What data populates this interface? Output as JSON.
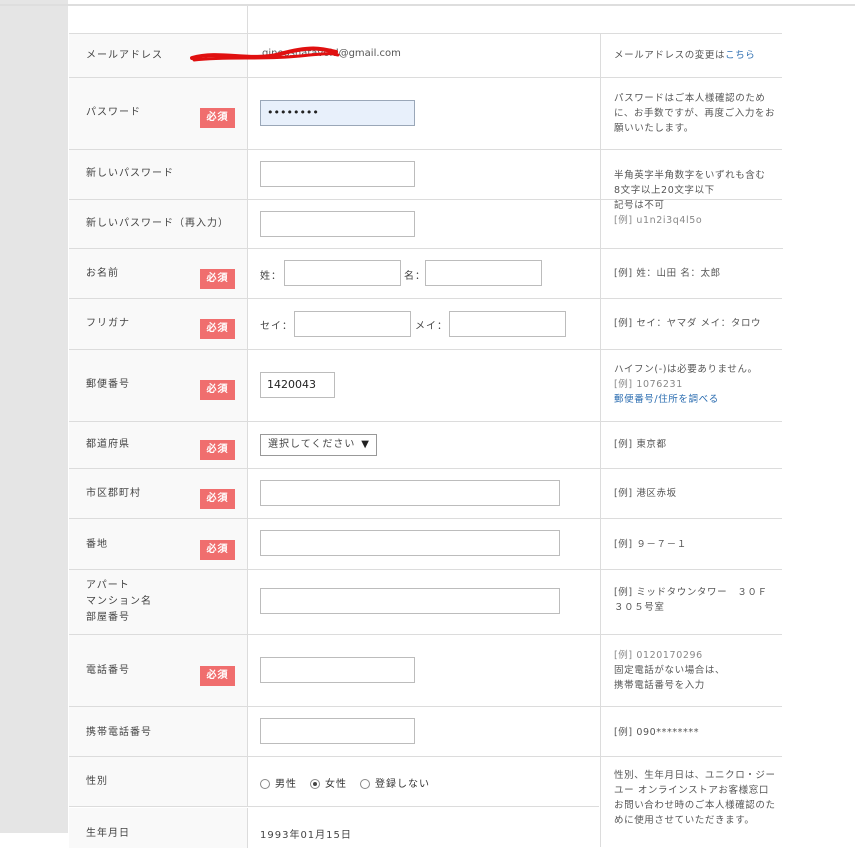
{
  "required_label": "必須",
  "email": {
    "label": "メールアドレス",
    "value": "ginooshatavoid@gmail.com",
    "note": "メールアドレスの変更は",
    "note_link": "こちら"
  },
  "password": {
    "label": "パスワード",
    "value": "••••••••",
    "note": "パスワードはご本人様確認のために、お手数ですが、再度ご入力をお願いいたします。"
  },
  "new_password": {
    "label": "新しいパスワード",
    "confirm_label": "新しいパスワード（再入力）",
    "note_lines": [
      "半角英字半角数字をいずれも含む",
      "8文字以上20文字以下",
      "記号は不可",
      "[例] u1n2i3q4l5o"
    ]
  },
  "name": {
    "label": "お名前",
    "sei": "姓：",
    "mei": "名：",
    "note": "[例] 姓：山田 名：太郎"
  },
  "furigana": {
    "label": "フリガナ",
    "sei": "セイ：",
    "mei": "メイ：",
    "note": "[例] セイ：ヤマダ メイ：タロウ"
  },
  "postal": {
    "label": "郵便番号",
    "value": "1420043",
    "note1": "ハイフン(-)は必要ありません。",
    "note2": "[例] 1076231",
    "note_link": "郵便番号/住所を調べる"
  },
  "prefecture": {
    "label": "都道府県",
    "select": "選択してください",
    "note": "[例] 東京都"
  },
  "city": {
    "label": "市区郡町村",
    "note": "[例] 港区赤坂"
  },
  "address": {
    "label": "番地",
    "note": "[例] ９－７－１"
  },
  "building": {
    "label_lines": [
      "アパート",
      "マンション名",
      "部屋番号"
    ],
    "note": "[例] ミッドタウンタワー　３０Ｆ　３０５号室"
  },
  "phone": {
    "label": "電話番号",
    "note_lines": [
      "[例] 0120170296",
      "固定電話がない場合は、",
      "携帯電話番号を入力"
    ]
  },
  "mobile": {
    "label": "携帯電話番号",
    "note": "[例] 090********"
  },
  "gender": {
    "label": "性別",
    "options": [
      "男性",
      "女性",
      "登録しない"
    ],
    "selected": "女性",
    "note": "性別、生年月日は、ユニクロ・ジーユー オンラインストアお客様窓口お問い合わせ時のご本人様確認のために使用させていただきます。"
  },
  "birthday": {
    "label": "生年月日",
    "value": "1993年01月15日"
  },
  "colors": {
    "required_bg": "#f06e6e",
    "link": "#2a6cb0",
    "autofill": "#e8f0fb"
  }
}
